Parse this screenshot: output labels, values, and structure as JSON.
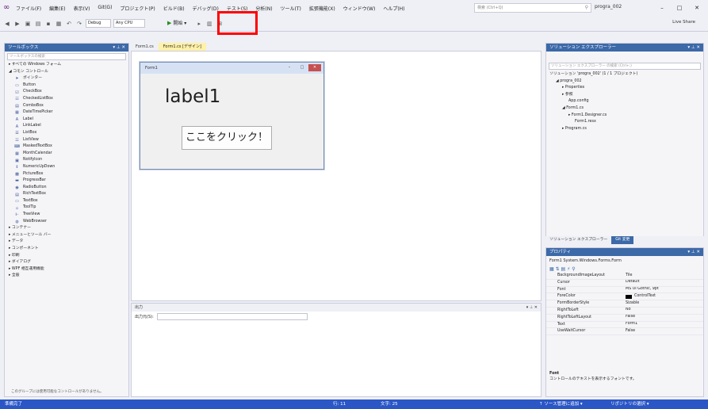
{
  "menu": {
    "items": [
      "ファイル(F)",
      "編集(E)",
      "表示(V)",
      "Git(G)",
      "プロジェクト(P)",
      "ビルド(B)",
      "デバッグ(D)",
      "テスト(S)",
      "分析(N)",
      "ツール(T)",
      "拡張機能(X)",
      "ウィンドウ(W)",
      "ヘルプ(H)"
    ],
    "search_placeholder": "検索 (Ctrl+Q)",
    "project_name": "progra_002"
  },
  "toolbar": {
    "config": "Debug",
    "platform": "Any CPU",
    "start_label": "開始 ▾",
    "live_share": "Live Share"
  },
  "toolbox": {
    "title": "ツールボックス",
    "search_placeholder": "ツールボックスの検索",
    "items": [
      {
        "label": "▸ すべての Windows フォーム",
        "icon": ""
      },
      {
        "label": "◢ コモン コントロール",
        "icon": ""
      },
      {
        "label": "ポインター",
        "icon": "➤"
      },
      {
        "label": "Button",
        "icon": "▭"
      },
      {
        "label": "CheckBox",
        "icon": "☑"
      },
      {
        "label": "CheckedListBox",
        "icon": "☷"
      },
      {
        "label": "ComboBox",
        "icon": "▤"
      },
      {
        "label": "DateTimePicker",
        "icon": "▦"
      },
      {
        "label": "Label",
        "icon": "A"
      },
      {
        "label": "LinkLabel",
        "icon": "A"
      },
      {
        "label": "ListBox",
        "icon": "☰"
      },
      {
        "label": "ListView",
        "icon": "☷"
      },
      {
        "label": "MaskedTextBox",
        "icon": "⌨"
      },
      {
        "label": "MonthCalendar",
        "icon": "▦"
      },
      {
        "label": "NotifyIcon",
        "icon": "▣"
      },
      {
        "label": "NumericUpDown",
        "icon": "⇕"
      },
      {
        "label": "PictureBox",
        "icon": "▩"
      },
      {
        "label": "ProgressBar",
        "icon": "▬"
      },
      {
        "label": "RadioButton",
        "icon": "◉"
      },
      {
        "label": "RichTextBox",
        "icon": "▤"
      },
      {
        "label": "TextBox",
        "icon": "▭"
      },
      {
        "label": "ToolTip",
        "icon": "▫"
      },
      {
        "label": "TreeView",
        "icon": "⊩"
      },
      {
        "label": "WebBrowser",
        "icon": "◍"
      },
      {
        "label": "▸ コンテナー",
        "icon": ""
      },
      {
        "label": "▸ メニューとツール バー",
        "icon": ""
      },
      {
        "label": "▸ データ",
        "icon": ""
      },
      {
        "label": "▸ コンポーネント",
        "icon": ""
      },
      {
        "label": "▸ 印刷",
        "icon": ""
      },
      {
        "label": "▸ ダイアログ",
        "icon": ""
      },
      {
        "label": "▸ WPF 相互運用機能",
        "icon": ""
      },
      {
        "label": "▸ 全般",
        "icon": ""
      }
    ],
    "footer": "このグループには使用可能なコントロールがありません。"
  },
  "doc_tabs": [
    "Form1.cs",
    "Form1.cs [デザイン]"
  ],
  "form": {
    "title": "Form1",
    "label_text": "label1",
    "button_text": "ここをクリック！"
  },
  "output": {
    "title": "出力",
    "source_label": "出力元(S):"
  },
  "solution": {
    "title": "ソリューション エクスプローラー",
    "search_placeholder": "ソリューション エクスプローラー の検索 (Ctrl+;)",
    "items": [
      {
        "label": "ソリューション 'progra_002' (1 / 1 プロジェクト)",
        "indent": 0
      },
      {
        "label": "◢ progra_002",
        "indent": 1
      },
      {
        "label": "▸ Properties",
        "indent": 2
      },
      {
        "label": "▸ 参照",
        "indent": 2
      },
      {
        "label": "App.config",
        "indent": 3
      },
      {
        "label": "◢ Form1.cs",
        "indent": 2
      },
      {
        "label": "▸ Form1.Designer.cs",
        "indent": 3
      },
      {
        "label": "Form1.resx",
        "indent": 4
      },
      {
        "label": "▸ Program.cs",
        "indent": 2
      }
    ],
    "bottom_tabs": [
      "ソリューション エクスプローラー",
      "Git 変更"
    ]
  },
  "props": {
    "title": "プロパティ",
    "object": "Form1 System.Windows.Forms.Form",
    "rows": [
      {
        "name": "BackgroundImageLayout",
        "value": "Tile",
        "swatch": false
      },
      {
        "name": "Cursor",
        "value": "Default",
        "swatch": false
      },
      {
        "name": "Font",
        "value": "MS UI Gothic, 9pt",
        "swatch": false
      },
      {
        "name": "ForeColor",
        "value": "ControlText",
        "swatch": true
      },
      {
        "name": "FormBorderStyle",
        "value": "Sizable",
        "swatch": false
      },
      {
        "name": "RightToLeft",
        "value": "No",
        "swatch": false
      },
      {
        "name": "RightToLeftLayout",
        "value": "False",
        "swatch": false
      },
      {
        "name": "Text",
        "value": "Form1",
        "swatch": false
      },
      {
        "name": "UseWaitCursor",
        "value": "False",
        "swatch": false
      }
    ],
    "desc_title": "Font",
    "desc_text": "コントロールのテキストを表示するフォントです。"
  },
  "status": {
    "left": "準備完了",
    "ln": "行: 11",
    "col": "文字: 25",
    "add_source": "↑ ソース管理に追加 ▾",
    "repo": "リポジトリの選択 ▾"
  }
}
